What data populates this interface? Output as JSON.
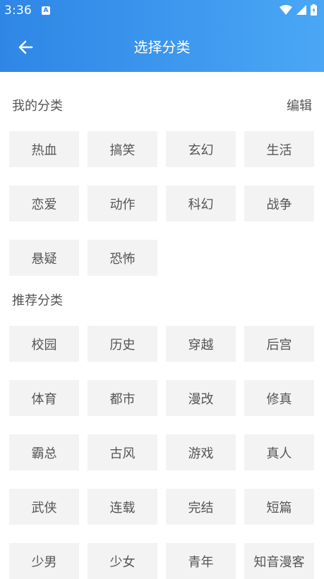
{
  "status_bar": {
    "time": "3:36",
    "notification_letter": "A"
  },
  "header": {
    "title": "选择分类",
    "back_icon": "arrow-left-icon"
  },
  "colors": {
    "header_gradient_start": "#2f86e6",
    "header_gradient_end": "#4aa7f5",
    "chip_bg": "#f3f3f3",
    "text": "#555555"
  },
  "my_categories": {
    "heading": "我的分类",
    "edit_label": "编辑",
    "items": [
      "热血",
      "搞笑",
      "玄幻",
      "生活",
      "恋爱",
      "动作",
      "科幻",
      "战争",
      "悬疑",
      "恐怖"
    ]
  },
  "recommended_categories": {
    "heading": "推荐分类",
    "items": [
      "校园",
      "历史",
      "穿越",
      "后宫",
      "体育",
      "都市",
      "漫改",
      "修真",
      "霸总",
      "古风",
      "游戏",
      "真人",
      "武侠",
      "连载",
      "完结",
      "短篇",
      "少男",
      "少女",
      "青年",
      "知音漫客"
    ]
  }
}
